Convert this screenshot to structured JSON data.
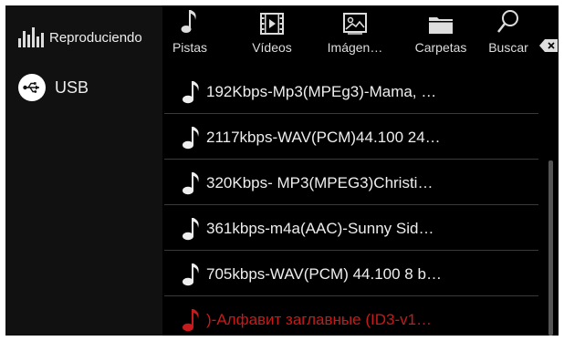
{
  "sidebar": {
    "now_playing_label": "Reproduciendo",
    "source_label": "USB"
  },
  "tabs": [
    {
      "label": "Pistas",
      "icon": "music-note-icon"
    },
    {
      "label": "Vídeos",
      "icon": "film-icon"
    },
    {
      "label": "Imágen…",
      "icon": "image-icon"
    },
    {
      "label": "Carpetas",
      "icon": "folder-icon"
    },
    {
      "label": "Buscar",
      "icon": "search-icon"
    }
  ],
  "tracks": [
    {
      "title": "192Kbps-Mp3(MPEg3)-Mama, …",
      "active": false
    },
    {
      "title": "2117kbps-WAV(PCM)44.100 24…",
      "active": false
    },
    {
      "title": "320Kbps- MP3(MPEG3)Christi…",
      "active": false
    },
    {
      "title": "361kbps-m4a(AAC)-Sunny Sid…",
      "active": false
    },
    {
      "title": "705kbps-WAV(PCM) 44.100 8 b…",
      "active": false
    },
    {
      "title": ")-Алфавит заглавные (ID3-v1…",
      "active": true
    }
  ],
  "colors": {
    "background": "#000000",
    "sidebar": "#111111",
    "text": "#eeeeee",
    "active_track": "#c81a1a"
  }
}
